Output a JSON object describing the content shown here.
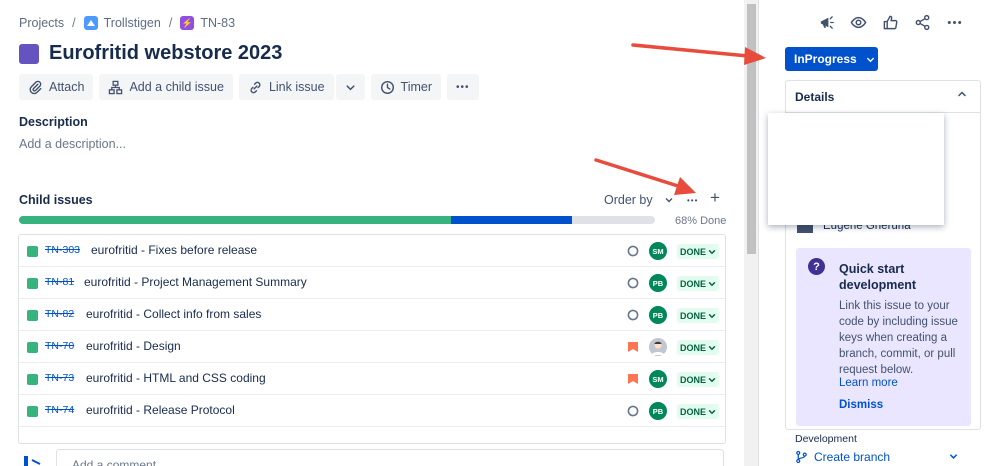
{
  "breadcrumb": {
    "projects": "Projects",
    "separator": "/",
    "project": "Trollstigen",
    "epic_key": "TN-83"
  },
  "page": {
    "title": "Eurofritid webstore 2023"
  },
  "toolbar": {
    "attach": "Attach",
    "add_child": "Add a child issue",
    "link_issue": "Link issue",
    "timer": "Timer",
    "more": "•••"
  },
  "description": {
    "label": "Description",
    "placeholder": "Add a description..."
  },
  "child_issues": {
    "label": "Child issues",
    "order_by": "Order by",
    "more": "•••",
    "add": "+",
    "progress_label": "68% Done",
    "progress": {
      "done_percent": 68,
      "in_progress_percent": 19
    },
    "items": [
      {
        "key": "TN-303",
        "summary": "eurofritid - Fixes before release",
        "type": "story-green",
        "assignee": "SM",
        "status": "DONE",
        "priority": "none"
      },
      {
        "key": "TN-81",
        "summary": "eurofritid - Project Management Summary",
        "type": "subtask-green",
        "assignee": "PB",
        "status": "DONE",
        "priority": "none"
      },
      {
        "key": "TN-82",
        "summary": "eurofritid - Collect info from sales",
        "type": "subtask-green",
        "assignee": "PB",
        "status": "DONE",
        "priority": "none"
      },
      {
        "key": "TN-70",
        "summary": "eurofritid - Design",
        "type": "subtask-green",
        "assignee": "",
        "status": "DONE",
        "priority": "high"
      },
      {
        "key": "TN-73",
        "summary": "eurofritid - HTML and CSS coding",
        "type": "story-green",
        "assignee": "SM",
        "status": "DONE",
        "priority": "high"
      },
      {
        "key": "TN-74",
        "summary": "eurofritid - Release Protocol",
        "type": "subtask-green",
        "assignee": "PB",
        "status": "DONE",
        "priority": "none"
      }
    ]
  },
  "comment": {
    "placeholder": "Add a comment..."
  },
  "sidebar": {
    "status_button": "InProgress",
    "details_header": "Details",
    "assignee": "Eugene Gneruna",
    "quick_start": {
      "title": "Quick start development",
      "body": "Link this issue to your code by including issue keys when creating a branch, commit, or pull request below.",
      "learn_more": "Learn more",
      "dismiss": "Dismiss"
    },
    "development": {
      "label": "Development",
      "create_branch": "Create branch"
    }
  },
  "colors": {
    "accent": "#0052cc",
    "done_green": "#36b37e",
    "epic_purple": "#6554c0",
    "status_done_bg": "#e3fcef",
    "priority_high": "#ff7452",
    "annotation_arrow": "#e74c3c"
  }
}
